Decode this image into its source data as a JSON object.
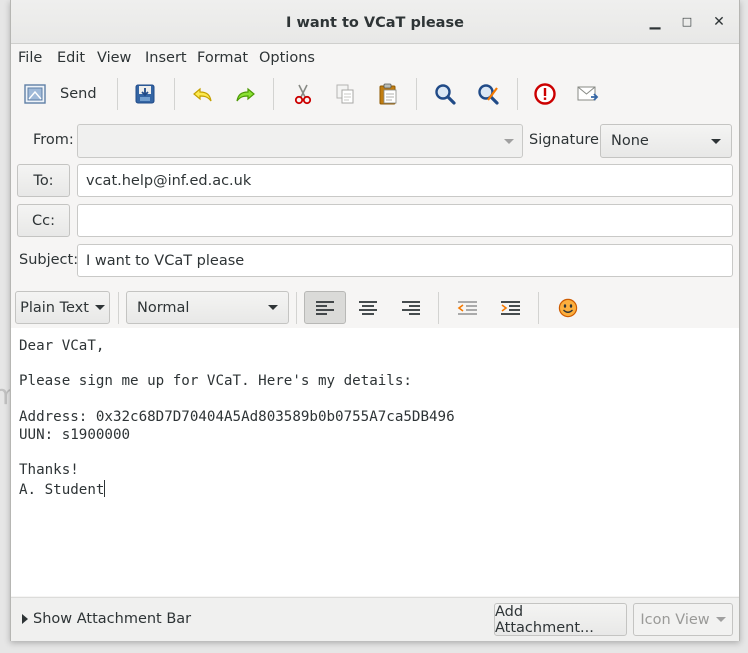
{
  "window": {
    "title": "I want to VCaT please",
    "minimize": "▁",
    "maximize": "□",
    "close": "✕"
  },
  "desktop": {
    "partial_text": "m"
  },
  "menu": [
    "File",
    "Edit",
    "View",
    "Insert",
    "Format",
    "Options"
  ],
  "toolbar": {
    "send_label": "Send",
    "icons": [
      "send-icon",
      "save-icon",
      "undo-icon",
      "redo-icon",
      "cut-icon",
      "copy-icon",
      "paste-icon",
      "find-icon",
      "replace-icon",
      "important-icon",
      "request-receipt-icon"
    ]
  },
  "header": {
    "from_label": "From:",
    "from_value": "",
    "signature_label": "Signature:",
    "signature_value": "None",
    "to_button": "To:",
    "to_value": "vcat.help@inf.ed.ac.uk",
    "cc_button": "Cc:",
    "cc_value": "",
    "subject_label": "Subject:",
    "subject_value": "I want to VCaT please"
  },
  "format": {
    "mode": "Plain Text",
    "paragraph_style": "Normal",
    "active_alignment": "left"
  },
  "editor": {
    "lines": [
      "Dear VCaT,",
      "",
      "Please sign me up for VCaT. Here's my details:",
      "",
      "Address: 0x32c68D7D70404A5Ad803589b0b0755A7ca5DB496",
      "UUN: s1900000",
      "",
      "Thanks!",
      "A. Student"
    ]
  },
  "bottom": {
    "show_attachment_bar": "Show Attachment Bar",
    "add_attachment": "Add Attachment...",
    "icon_view": "Icon View"
  },
  "colors": {
    "accent_red": "#cc0000",
    "undo_yellow": "#c4a000",
    "redo_green": "#73d216",
    "find_blue": "#204a87"
  }
}
